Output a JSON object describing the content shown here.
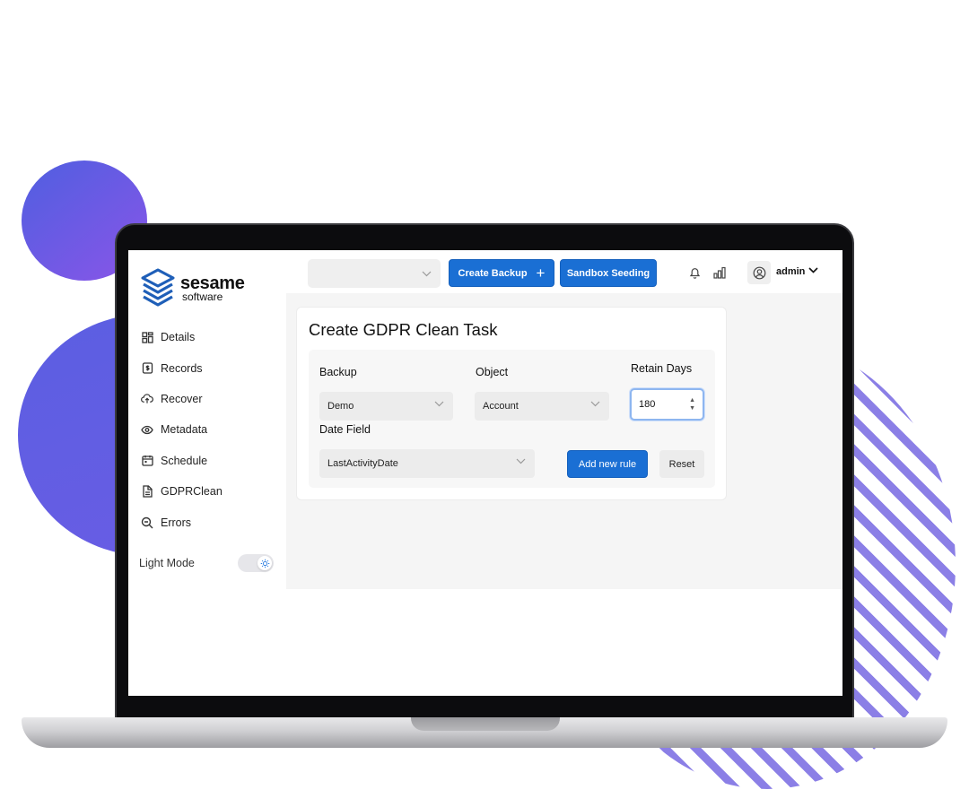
{
  "brand": {
    "name": "sesame",
    "tagline": "software",
    "logo_icon": "stacked-layers-logo",
    "accent_color": "#1a6fd4"
  },
  "sidebar": {
    "items": [
      {
        "label": "Details",
        "icon": "grid-icon"
      },
      {
        "label": "Records",
        "icon": "document-dollar-icon"
      },
      {
        "label": "Recover",
        "icon": "cloud-upload-icon"
      },
      {
        "label": "Metadata",
        "icon": "eye-icon"
      },
      {
        "label": "Schedule",
        "icon": "calendar-icon"
      },
      {
        "label": "GDPRClean",
        "icon": "file-icon"
      },
      {
        "label": "Errors",
        "icon": "magnifier-icon"
      }
    ],
    "light_mode": {
      "label": "Light Mode",
      "icon": "sun-icon",
      "enabled": true
    }
  },
  "topbar": {
    "org_select_value": "",
    "create_backup_label": "Create Backup",
    "sandbox_seeding_label": "Sandbox Seeding",
    "user_name": "admin"
  },
  "task": {
    "title": "Create GDPR Clean Task",
    "backup_label": "Backup",
    "backup_value": "Demo",
    "object_label": "Object",
    "object_value": "Account",
    "retain_days_label": "Retain Days",
    "retain_days_value": "180",
    "date_field_label": "Date Field",
    "date_field_value": "LastActivityDate",
    "add_rule_label": "Add new rule",
    "reset_label": "Reset"
  }
}
